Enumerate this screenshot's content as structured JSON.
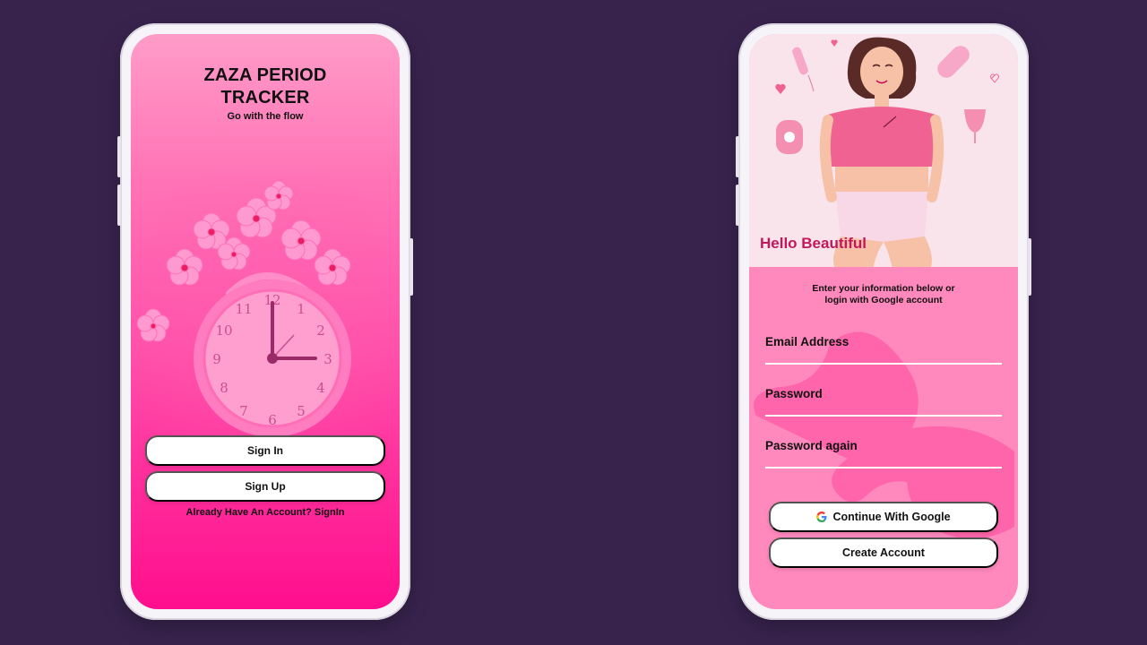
{
  "left_screen": {
    "title_line1": "ZAZA PERIOD",
    "title_line2": "TRACKER",
    "subtitle": "Go with the flow",
    "sign_in_label": "Sign In",
    "sign_up_label": "Sign Up",
    "signin_link": "Already Have An Account? SignIn"
  },
  "right_screen": {
    "greeting": "Hello Beautiful",
    "intro_line1": "Enter your information below or",
    "intro_line2": "login with Google account",
    "fields": [
      {
        "label": "Email Address",
        "value": ""
      },
      {
        "label": "Password",
        "value": ""
      },
      {
        "label": "Password again",
        "value": ""
      }
    ],
    "google_button_label": "Continue With Google",
    "create_account_label": "Create Account"
  },
  "icons": [
    "clock-icon",
    "flower-icon",
    "google-icon",
    "woman-illustration",
    "tampon-icon",
    "pad-icon",
    "menstrual-cup-icon",
    "heart-icon"
  ],
  "colors": {
    "background": "#38234d",
    "accent_pink": "#ff0e8d",
    "light_pink": "#ff88bd",
    "greeting_color": "#c2185b",
    "button_bg": "#ffffff"
  }
}
